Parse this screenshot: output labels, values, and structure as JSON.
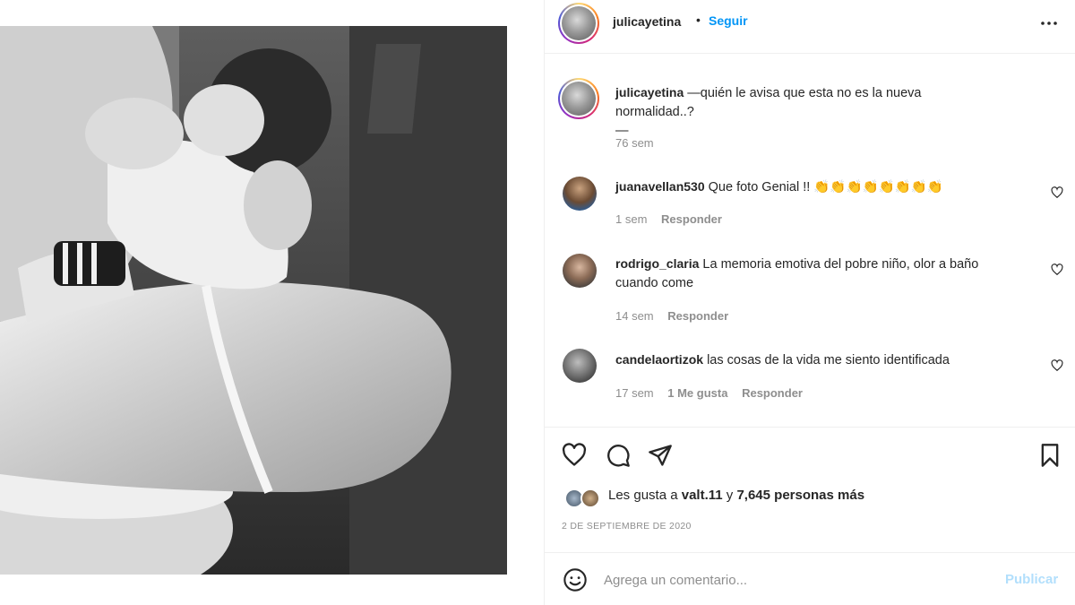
{
  "post": {
    "author": "julicayetina",
    "dot": "•",
    "follow_label": "Seguir",
    "more_icon": "more-horizontal-icon"
  },
  "caption": {
    "username": "julicayetina",
    "text": "—quién le avisa que esta no es la nueva normalidad..?",
    "text_line2": "—",
    "time": "76 sem"
  },
  "comments": [
    {
      "username": "juanavellan530",
      "text": "Que foto Genial !! 👏👏👏👏👏👏👏👏",
      "text_line2": "",
      "time": "1 sem",
      "likes": "",
      "reply_label": "Responder"
    },
    {
      "username": "rodrigo_claria",
      "text": "La memoria emotiva del pobre niño, olor a baño",
      "text_line2": "cuando come",
      "time": "14 sem",
      "likes": "",
      "reply_label": "Responder"
    },
    {
      "username": "candelaortizok",
      "text": "las cosas de la vida me siento identificada",
      "text_line2": "",
      "time": "17 sem",
      "likes": "1 Me gusta",
      "reply_label": "Responder"
    }
  ],
  "actions": {
    "like_icon": "heart-icon",
    "comment_icon": "comment-icon",
    "share_icon": "send-icon",
    "save_icon": "bookmark-icon"
  },
  "likes": {
    "prefix": "Les gusta a ",
    "user": "valt.11",
    "middle": " y ",
    "count": "7,645 personas más"
  },
  "date": "2 de septiembre de 2020",
  "add_comment": {
    "placeholder": "Agrega un comentario...",
    "publish_label": "Publicar",
    "emoji_icon": "smiley-icon"
  },
  "colors": {
    "link_blue": "#0095f6",
    "publish_disabled": "#b2dffc",
    "muted_text": "#8e8e8e",
    "border": "#efefef"
  }
}
